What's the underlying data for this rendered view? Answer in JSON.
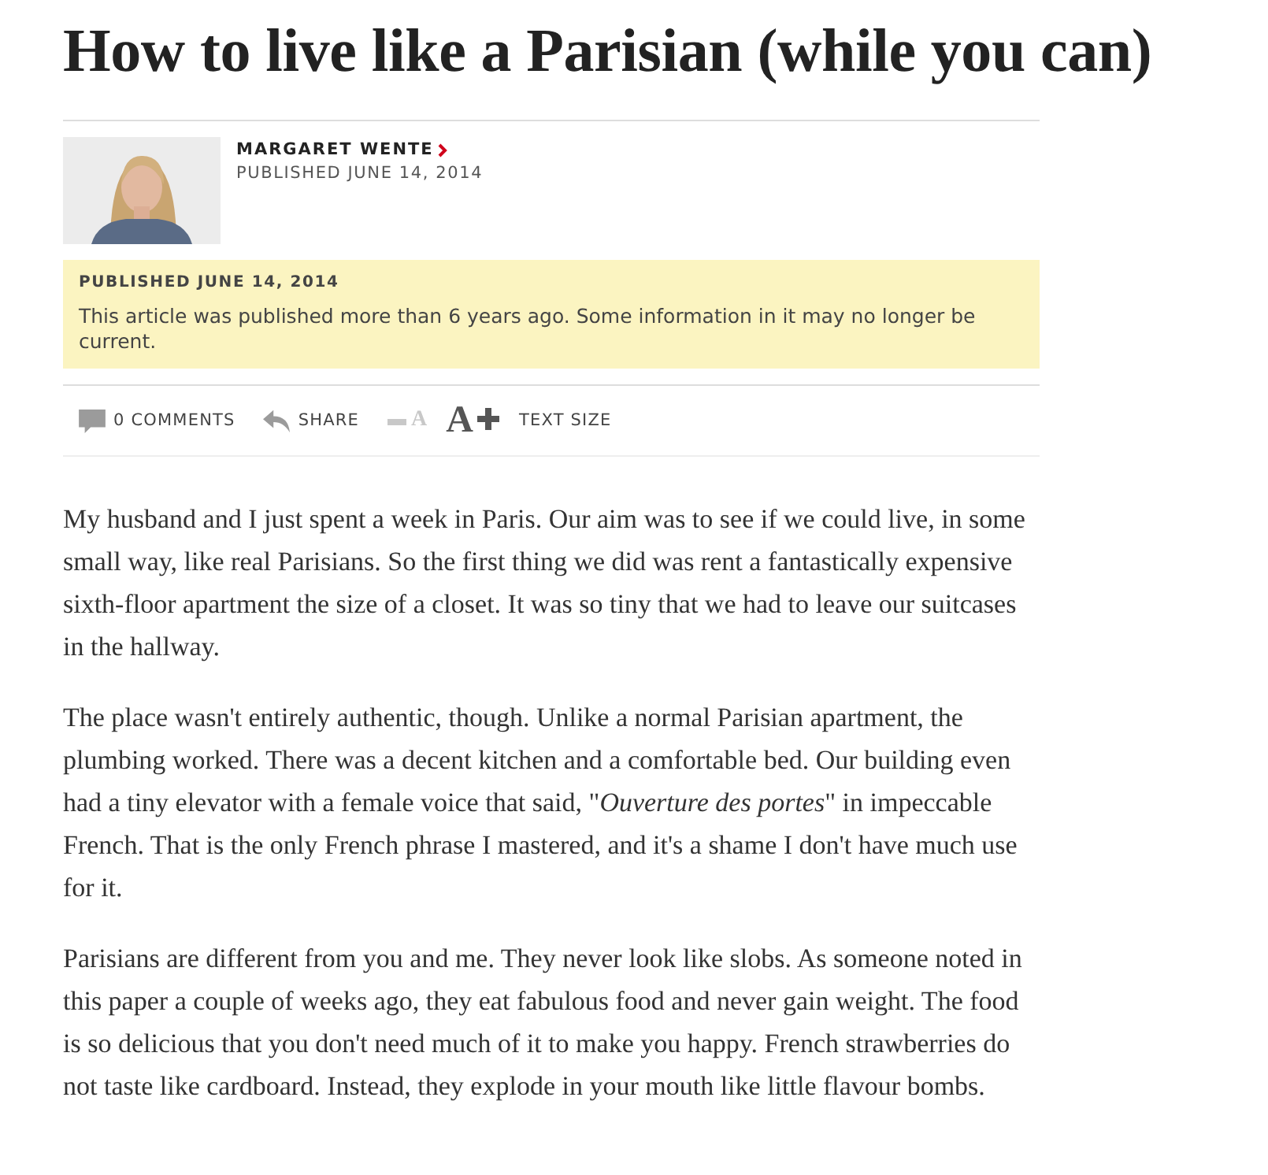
{
  "headline": "How to live like a Parisian (while you can)",
  "byline": {
    "author": "MARGARET WENTE",
    "published": "PUBLISHED JUNE 14, 2014"
  },
  "notice": {
    "title": "PUBLISHED JUNE 14, 2014",
    "text": "This article was published more than 6 years ago. Some information in it may no longer be current."
  },
  "toolbar": {
    "comments": "0 COMMENTS",
    "share": "SHARE",
    "decrease_letter": "A",
    "increase_letter": "A",
    "text_size": "TEXT SIZE"
  },
  "paragraphs": [
    "My husband and I just spent a week in Paris. Our aim was to see if we could live, in some small way, like real Parisians. So the first thing we did was rent a fantastically expensive sixth-floor apartment the size of a closet. It was so tiny that we had to leave our suitcases in the hallway.",
    "The place wasn't entirely authentic, though. Unlike a normal Parisian apartment, the plumbing worked. There was a decent kitchen and a comfortable bed. Our building even had a tiny elevator with a female voice that said, \"*Ouverture des portes*\" in impeccable French. That is the only French phrase I mastered, and it's a shame I don't have much use for it.",
    "Parisians are different from you and me. They never look like slobs. As someone noted in this paper a couple of weeks ago, they eat fabulous food and never gain weight. The food is so delicious that you don't need much of it to make you happy. French strawberries do not taste like cardboard. Instead, they explode in your mouth like little flavour bombs."
  ]
}
